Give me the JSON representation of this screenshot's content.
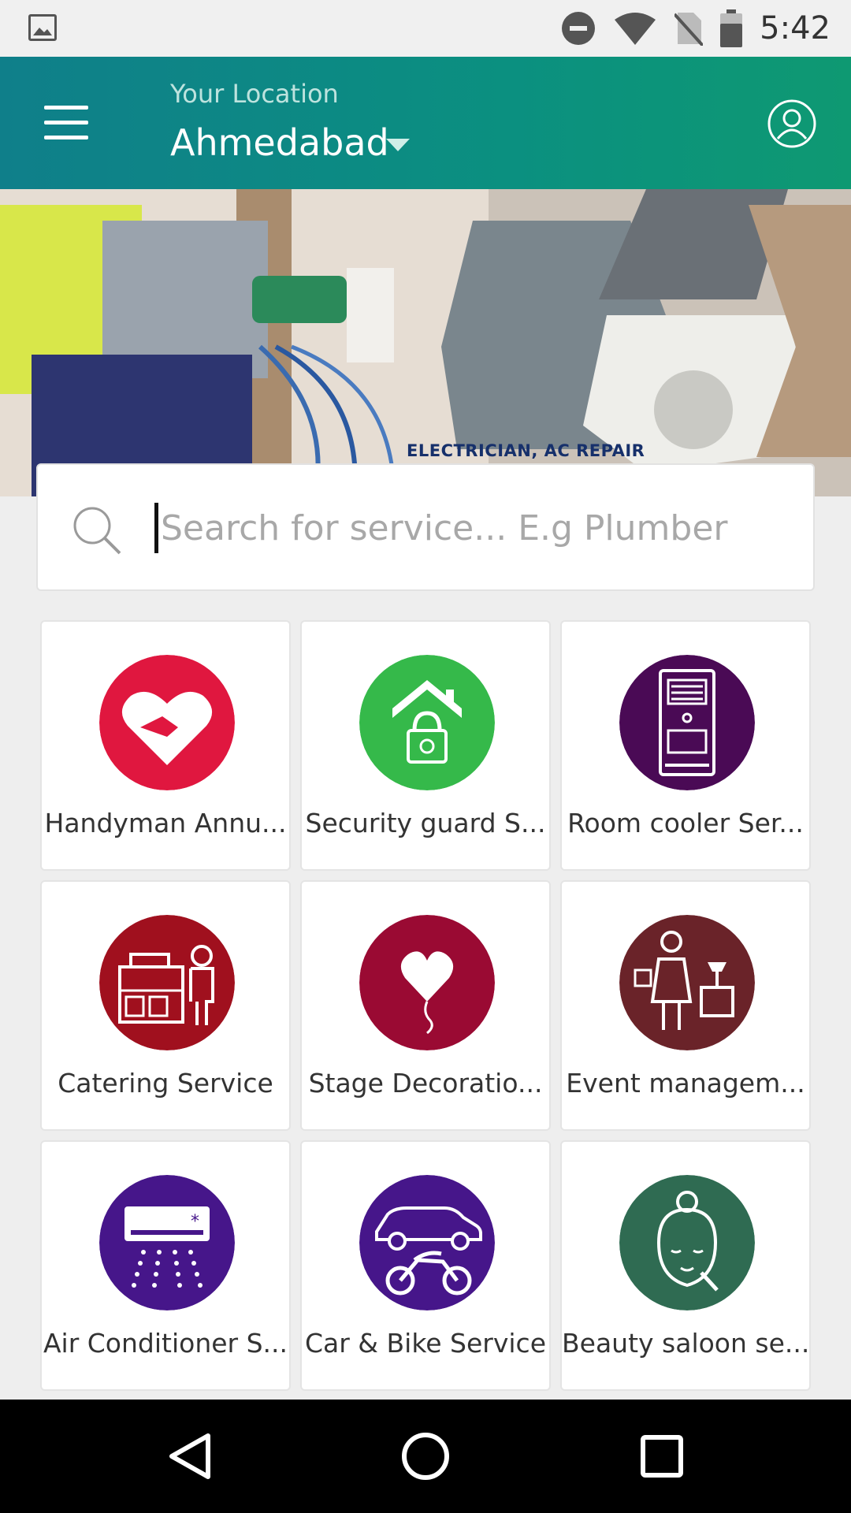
{
  "status_bar": {
    "time": "5:42",
    "icons": [
      "gallery-icon",
      "do-not-disturb-icon",
      "wifi-icon",
      "no-sim-icon",
      "battery-icon"
    ]
  },
  "app_bar": {
    "location_label": "Your Location",
    "city": "Ahmedabad",
    "icons": [
      "hamburger-menu-icon",
      "dropdown-caret-icon",
      "profile-icon"
    ],
    "gradient_start": "#0f7f8a",
    "gradient_end": "#0e9972"
  },
  "banner": {
    "caption": "ELECTRICIAN, AC REPAIR"
  },
  "search": {
    "placeholder": "Search for service... E.g Plumber",
    "value": ""
  },
  "services": [
    {
      "label": "Handyman Annu...",
      "icon": "handshake-heart-icon",
      "color": "#e0173f"
    },
    {
      "label": "Security guard S...",
      "icon": "house-lock-icon",
      "color": "#35b94a"
    },
    {
      "label": "Room cooler Ser...",
      "icon": "air-cooler-icon",
      "color": "#4a0a55"
    },
    {
      "label": "Catering  Service",
      "icon": "catering-icon",
      "color": "#a0101e"
    },
    {
      "label": "Stage Decoratio...",
      "icon": "heart-balloon-icon",
      "color": "#9a0a33"
    },
    {
      "label": "Event managem...",
      "icon": "event-manager-icon",
      "color": "#6a2329"
    },
    {
      "label": "Air Conditioner S...",
      "icon": "air-conditioner-icon",
      "color": "#46168a"
    },
    {
      "label": "Car & Bike Service",
      "icon": "car-bike-icon",
      "color": "#46168a"
    },
    {
      "label": "Beauty saloon se...",
      "icon": "beauty-face-icon",
      "color": "#2f6b52"
    }
  ],
  "nav_bar": {
    "icons": [
      "back-icon",
      "home-icon",
      "recents-icon"
    ]
  }
}
